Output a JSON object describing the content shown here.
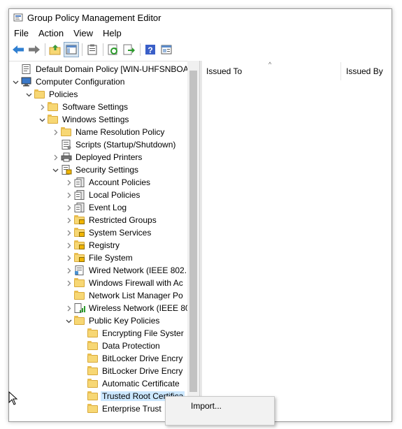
{
  "window": {
    "title": "Group Policy Management Editor"
  },
  "menubar": {
    "items": [
      "File",
      "Action",
      "View",
      "Help"
    ]
  },
  "toolbar": {
    "buttons": [
      {
        "icon": "back-arrow-icon"
      },
      {
        "icon": "forward-arrow-icon"
      },
      {
        "icon": "up-folder-icon"
      },
      {
        "icon": "show-hide-console-tree-icon"
      },
      {
        "icon": "clipboard-icon"
      },
      {
        "icon": "refresh-icon"
      },
      {
        "icon": "export-list-icon"
      },
      {
        "icon": "help-icon"
      },
      {
        "icon": "properties-icon"
      }
    ]
  },
  "tree": {
    "items": [
      {
        "label": "Default Domain Policy [WIN-UHFSNBOAAI",
        "level": 0,
        "expander": "none",
        "icon": "policy-icon"
      },
      {
        "label": "Computer Configuration",
        "level": 0,
        "expander": "expanded",
        "icon": "computer-icon"
      },
      {
        "label": "Policies",
        "level": 1,
        "expander": "expanded",
        "icon": "folder-icon"
      },
      {
        "label": "Software Settings",
        "level": 2,
        "expander": "collapsed",
        "icon": "folder-icon"
      },
      {
        "label": "Windows Settings",
        "level": 2,
        "expander": "expanded",
        "icon": "folder-icon"
      },
      {
        "label": "Name Resolution Policy",
        "level": 3,
        "expander": "collapsed",
        "icon": "folder-icon"
      },
      {
        "label": "Scripts (Startup/Shutdown)",
        "level": 3,
        "expander": "none",
        "icon": "script-icon"
      },
      {
        "label": "Deployed Printers",
        "level": 3,
        "expander": "collapsed",
        "icon": "printer-icon"
      },
      {
        "label": "Security Settings",
        "level": 3,
        "expander": "expanded",
        "icon": "security-icon"
      },
      {
        "label": "Account Policies",
        "level": 4,
        "expander": "collapsed",
        "icon": "policy-doc-icon"
      },
      {
        "label": "Local Policies",
        "level": 4,
        "expander": "collapsed",
        "icon": "policy-doc-icon"
      },
      {
        "label": "Event Log",
        "level": 4,
        "expander": "collapsed",
        "icon": "policy-doc-icon"
      },
      {
        "label": "Restricted Groups",
        "level": 4,
        "expander": "collapsed",
        "icon": "locked-folder-icon"
      },
      {
        "label": "System Services",
        "level": 4,
        "expander": "collapsed",
        "icon": "locked-folder-icon"
      },
      {
        "label": "Registry",
        "level": 4,
        "expander": "collapsed",
        "icon": "locked-folder-icon"
      },
      {
        "label": "File System",
        "level": 4,
        "expander": "collapsed",
        "icon": "locked-folder-icon"
      },
      {
        "label": "Wired Network (IEEE 802.",
        "level": 4,
        "expander": "collapsed",
        "icon": "network-icon"
      },
      {
        "label": "Windows Firewall with Ac",
        "level": 4,
        "expander": "collapsed",
        "icon": "folder-icon"
      },
      {
        "label": "Network List Manager Po",
        "level": 4,
        "expander": "none",
        "icon": "folder-icon"
      },
      {
        "label": "Wireless Network (IEEE 80",
        "level": 4,
        "expander": "collapsed",
        "icon": "wireless-icon"
      },
      {
        "label": "Public Key Policies",
        "level": 4,
        "expander": "expanded",
        "icon": "folder-icon"
      },
      {
        "label": "Encrypting File Syster",
        "level": 5,
        "expander": "none",
        "icon": "folder-icon"
      },
      {
        "label": "Data Protection",
        "level": 5,
        "expander": "none",
        "icon": "folder-icon"
      },
      {
        "label": "BitLocker Drive Encry",
        "level": 5,
        "expander": "none",
        "icon": "folder-icon"
      },
      {
        "label": "BitLocker Drive Encry",
        "level": 5,
        "expander": "none",
        "icon": "folder-icon"
      },
      {
        "label": "Automatic Certificate",
        "level": 5,
        "expander": "none",
        "icon": "folder-icon"
      },
      {
        "label": "Trusted Root Certifica",
        "level": 5,
        "expander": "none",
        "icon": "folder-icon",
        "selected": true
      },
      {
        "label": "Enterprise Trust",
        "level": 5,
        "expander": "none",
        "icon": "folder-icon"
      }
    ]
  },
  "list": {
    "columns": [
      "Issued To",
      "Issued By"
    ],
    "sorted_column": "Issued To"
  },
  "context_menu": {
    "items": [
      "Import..."
    ]
  },
  "colors": {
    "selection": "#cce8ff",
    "folder": "#f7d774"
  }
}
